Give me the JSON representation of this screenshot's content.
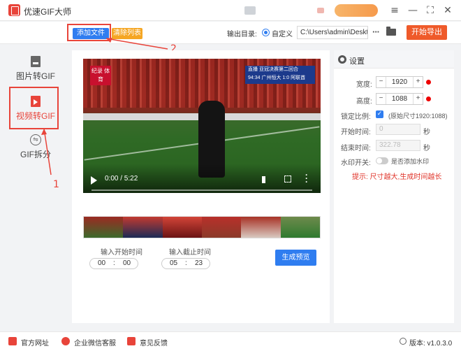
{
  "app": {
    "title": "优速GIF大师"
  },
  "window_controls": {
    "menu": "≡",
    "minimize": "—",
    "maximize": "⛶",
    "close": "✕"
  },
  "toolbar": {
    "add_file_label": "添加文件",
    "clear_list_label": "清除列表",
    "output_dir_label": "输出目录:",
    "custom_option_label": "自定义",
    "output_path": "C:\\Users\\admin\\Deskto",
    "more_label": "···",
    "start_export_label": "开始导出"
  },
  "sidebar": {
    "items": [
      {
        "label": "图片转GIF",
        "icon": "image-doc-icon",
        "active": false
      },
      {
        "label": "视频转GIF",
        "icon": "video-doc-icon",
        "active": true
      },
      {
        "label": "GIF拆分",
        "icon": "split-icon",
        "active": false
      }
    ]
  },
  "annotations": {
    "marker_1": "1",
    "marker_2": "2"
  },
  "video": {
    "logo_text": "纪录 体育",
    "score_line1": "直播 亚冠决赛第二回合",
    "score_line2": "94:34 广州恒大 1:0 阿联酋",
    "time": "0:00 / 5:22"
  },
  "range": {
    "start_label": "输入开始时间",
    "end_label": "输入截止时间",
    "start_min": "00",
    "start_sec": "00",
    "end_min": "05",
    "end_sec": "23",
    "separator": ":"
  },
  "preview_button_label": "生成预览",
  "settings": {
    "title": "设置",
    "width_label": "宽度:",
    "width_value": "1920",
    "height_label": "高度:",
    "height_value": "1088",
    "lock_ratio_label": "锁定比例:",
    "original_size": "(原始尺寸1920:1088)",
    "start_time_label": "开始时间:",
    "start_time_value": "0",
    "end_time_label": "结束时间:",
    "end_time_value": "322.78",
    "sec_unit": "秒",
    "watermark_label": "水印开关:",
    "watermark_toggle_label": "是否添加水印",
    "tip": "提示: 尺寸越大,生成时间越长",
    "minus": "−",
    "plus": "+"
  },
  "footer": {
    "website_label": "官方网址",
    "wechat_label": "企业微信客服",
    "feedback_label": "意见反馈",
    "version_label": "版本: v1.0.3.0"
  },
  "colors": {
    "accent_blue": "#2f7df0",
    "accent_red": "#e8443a",
    "export_orange": "#ef5a2a",
    "clear_orange": "#f5a623"
  }
}
